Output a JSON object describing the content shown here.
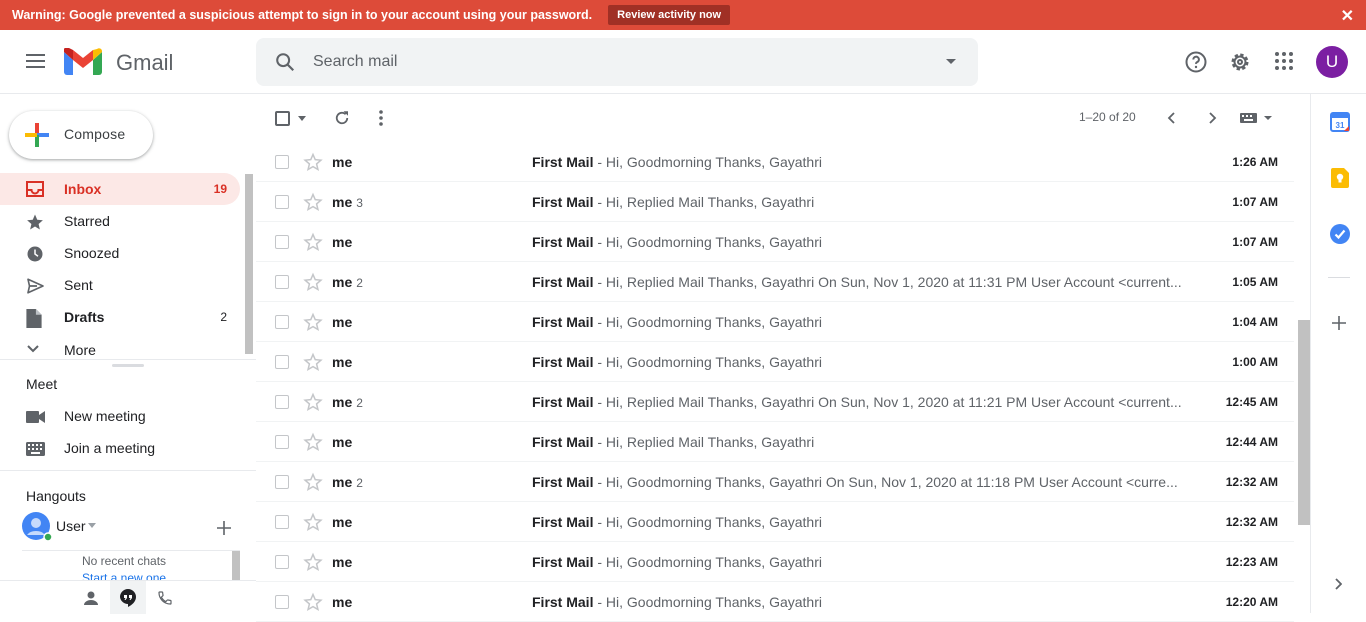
{
  "warning": {
    "text": "Warning: Google prevented a suspicious attempt to sign in to your account using your password.",
    "button": "Review activity now",
    "close": "✕"
  },
  "header": {
    "brand": "Gmail",
    "search_placeholder": "Search mail",
    "avatar_letter": "U"
  },
  "sidebar": {
    "compose": "Compose",
    "items": [
      {
        "label": "Inbox",
        "count": "19",
        "icon": "inbox-icon"
      },
      {
        "label": "Starred",
        "count": "",
        "icon": "star-icon"
      },
      {
        "label": "Snoozed",
        "count": "",
        "icon": "clock-icon"
      },
      {
        "label": "Sent",
        "count": "",
        "icon": "send-icon"
      },
      {
        "label": "Drafts",
        "count": "2",
        "icon": "draft-icon"
      },
      {
        "label": "More",
        "count": "",
        "icon": "chevron-down-icon"
      }
    ],
    "meet": {
      "title": "Meet",
      "new_meeting": "New meeting",
      "join": "Join a meeting"
    },
    "hangouts": {
      "title": "Hangouts",
      "user": "User",
      "no_chats": "No recent chats",
      "start_chat": "Start a new one"
    }
  },
  "toolbar": {
    "pagination": "1–20 of 20"
  },
  "emails": [
    {
      "from": "me",
      "count": "",
      "subject": "First Mail",
      "snippet": " - Hi, Goodmorning Thanks, Gayathri",
      "time": "1:26 AM"
    },
    {
      "from": "me",
      "count": "3",
      "subject": "First Mail",
      "snippet": " - Hi, Replied Mail Thanks, Gayathri",
      "time": "1:07 AM"
    },
    {
      "from": "me",
      "count": "",
      "subject": "First Mail",
      "snippet": " - Hi, Goodmorning Thanks, Gayathri",
      "time": "1:07 AM"
    },
    {
      "from": "me",
      "count": "2",
      "subject": "First Mail",
      "snippet": " - Hi, Replied Mail Thanks, Gayathri On Sun, Nov 1, 2020 at 11:31 PM User Account <current...",
      "time": "1:05 AM"
    },
    {
      "from": "me",
      "count": "",
      "subject": "First Mail",
      "snippet": " - Hi, Goodmorning Thanks, Gayathri",
      "time": "1:04 AM"
    },
    {
      "from": "me",
      "count": "",
      "subject": "First Mail",
      "snippet": " - Hi, Goodmorning Thanks, Gayathri",
      "time": "1:00 AM"
    },
    {
      "from": "me",
      "count": "2",
      "subject": "First Mail",
      "snippet": " - Hi, Replied Mail Thanks, Gayathri On Sun, Nov 1, 2020 at 11:21 PM User Account <current...",
      "time": "12:45 AM"
    },
    {
      "from": "me",
      "count": "",
      "subject": "First Mail",
      "snippet": " - Hi, Replied Mail Thanks, Gayathri",
      "time": "12:44 AM"
    },
    {
      "from": "me",
      "count": "2",
      "subject": "First Mail",
      "snippet": " - Hi, Goodmorning Thanks, Gayathri On Sun, Nov 1, 2020 at 11:18 PM User Account <curre...",
      "time": "12:32 AM"
    },
    {
      "from": "me",
      "count": "",
      "subject": "First Mail",
      "snippet": " - Hi, Goodmorning Thanks, Gayathri",
      "time": "12:32 AM"
    },
    {
      "from": "me",
      "count": "",
      "subject": "First Mail",
      "snippet": " - Hi, Goodmorning Thanks, Gayathri",
      "time": "12:23 AM"
    },
    {
      "from": "me",
      "count": "",
      "subject": "First Mail",
      "snippet": " - Hi, Goodmorning Thanks, Gayathri",
      "time": "12:20 AM"
    }
  ]
}
